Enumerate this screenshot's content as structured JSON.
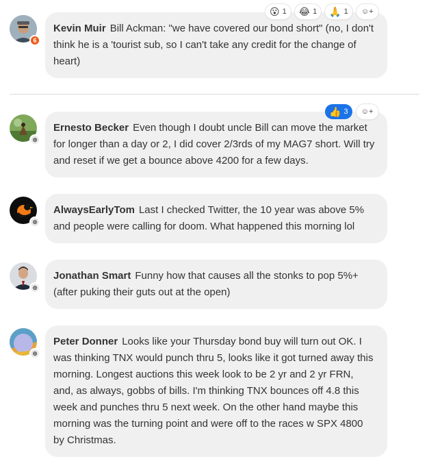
{
  "comments": [
    {
      "author": "Kevin Muir",
      "text": "Bill Ackman: \"we have covered our bond short\" (no, I don't think he is a 'tourist sub, so I can't take any credit for the change of heart)",
      "badge": "6",
      "reactions": [
        {
          "emoji": "😮",
          "count": "1"
        },
        {
          "emoji": "😂",
          "count": "1"
        },
        {
          "emoji": "🙏",
          "count": "1"
        }
      ]
    },
    {
      "author": "Ernesto Becker",
      "text": "Even though I doubt uncle Bill can move the market for longer than a day or 2, I did cover 2/3rds of my MAG7 short. Will try and reset if we get a bounce above 4200 for a few days.",
      "badge": "⊕",
      "reactions": [
        {
          "emoji": "👍",
          "count": "3"
        }
      ]
    },
    {
      "author": "AlwaysEarlyTom",
      "text": "Last I checked Twitter, the 10 year was above 5% and people were calling for doom. What happened this morning lol",
      "badge": "⊕"
    },
    {
      "author": "Jonathan Smart",
      "text": "Funny how that causes all the stonks to pop 5%+ (after puking their guts out at the open)",
      "badge": "⊕"
    },
    {
      "author": "Peter Donner",
      "text": "Looks like your Thursday bond buy will turn out OK. I was thinking TNX would punch thru 5, looks like it got turned away this morning. Longest auctions this week look to be 2 yr and 2 yr FRN, and, as always, gobbs of bills. I'm thinking TNX bounces off 4.8 this week and punches thru 5 next week. On the other hand maybe this morning was the turning point and were off to the races w SPX 4800 by Christmas.",
      "badge": "⊕"
    }
  ],
  "add_reaction_glyph": "☺+",
  "colors": {
    "bubble": "#f0f0f0",
    "active_reaction": "#1a73e8",
    "admin_badge": "#f05a1a"
  }
}
